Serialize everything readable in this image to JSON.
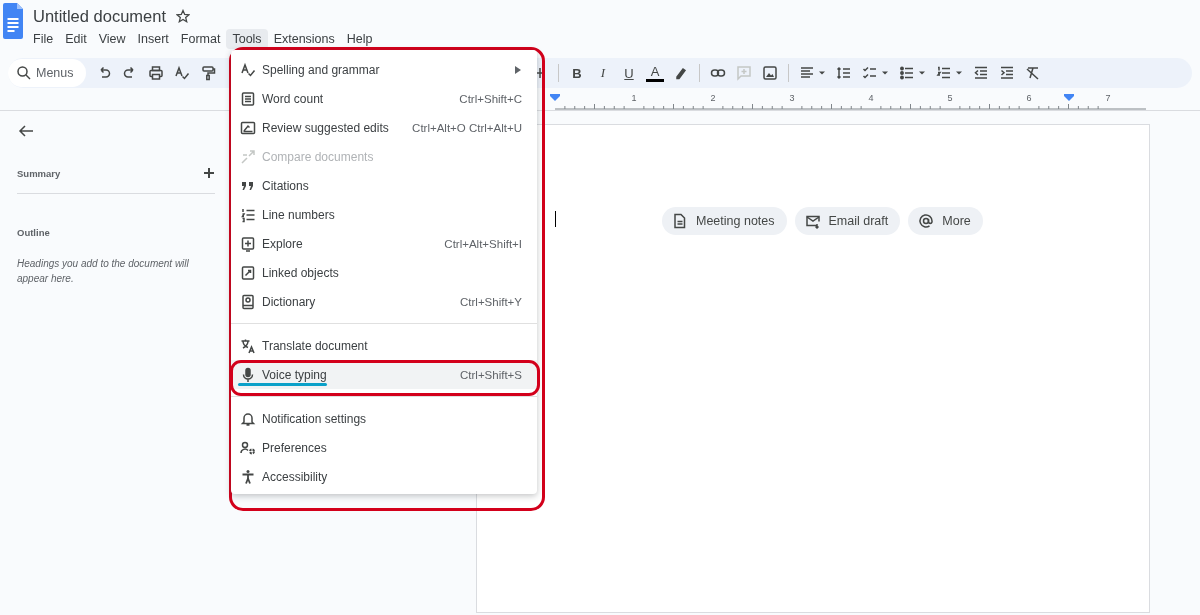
{
  "document": {
    "title": "Untitled document"
  },
  "menubar": [
    {
      "label": "File",
      "selected": false
    },
    {
      "label": "Edit",
      "selected": false
    },
    {
      "label": "View",
      "selected": false
    },
    {
      "label": "Insert",
      "selected": false
    },
    {
      "label": "Format",
      "selected": false
    },
    {
      "label": "Tools",
      "selected": true
    },
    {
      "label": "Extensions",
      "selected": false
    },
    {
      "label": "Help",
      "selected": false
    }
  ],
  "toolbar": {
    "search": {
      "placeholder": "Menus"
    },
    "format_letters": [
      "B",
      "I",
      "U",
      "A"
    ]
  },
  "ruler": {
    "labels": [
      "1",
      "2",
      "3",
      "4",
      "5",
      "6",
      "7"
    ]
  },
  "sidebar": {
    "summary_heading": "Summary",
    "outline_heading": "Outline",
    "outline_hint": "Headings you add to the document will appear here."
  },
  "page": {
    "chips": [
      {
        "label": "Meeting notes"
      },
      {
        "label": "Email draft"
      },
      {
        "label": "More"
      }
    ]
  },
  "tools_menu": {
    "circled": true,
    "items": [
      {
        "kind": "item",
        "label": "Spelling and grammar",
        "submenu": true,
        "disabled": false,
        "highlighted": false,
        "circled": false
      },
      {
        "kind": "item",
        "label": "Word count",
        "shortcut": "Ctrl+Shift+C",
        "submenu": false,
        "disabled": false,
        "highlighted": false,
        "circled": false
      },
      {
        "kind": "item",
        "label": "Review suggested edits",
        "shortcut": "Ctrl+Alt+O Ctrl+Alt+U",
        "submenu": false,
        "disabled": false,
        "highlighted": false,
        "circled": false
      },
      {
        "kind": "item",
        "label": "Compare documents",
        "submenu": false,
        "disabled": true,
        "highlighted": false,
        "circled": false
      },
      {
        "kind": "item",
        "label": "Citations",
        "submenu": false,
        "disabled": false,
        "highlighted": false,
        "circled": false
      },
      {
        "kind": "item",
        "label": "Line numbers",
        "submenu": false,
        "disabled": false,
        "highlighted": false,
        "circled": false
      },
      {
        "kind": "item",
        "label": "Explore",
        "shortcut": "Ctrl+Alt+Shift+I",
        "submenu": false,
        "disabled": false,
        "highlighted": false,
        "circled": false
      },
      {
        "kind": "item",
        "label": "Linked objects",
        "submenu": false,
        "disabled": false,
        "highlighted": false,
        "circled": false
      },
      {
        "kind": "item",
        "label": "Dictionary",
        "shortcut": "Ctrl+Shift+Y",
        "submenu": false,
        "disabled": false,
        "highlighted": false,
        "circled": false
      },
      {
        "kind": "divider"
      },
      {
        "kind": "item",
        "label": "Translate document",
        "submenu": false,
        "disabled": false,
        "highlighted": false,
        "circled": false
      },
      {
        "kind": "item",
        "label": "Voice typing",
        "shortcut": "Ctrl+Shift+S",
        "submenu": false,
        "disabled": false,
        "highlighted": true,
        "circled": true
      },
      {
        "kind": "divider"
      },
      {
        "kind": "item",
        "label": "Notification settings",
        "submenu": false,
        "disabled": false,
        "highlighted": false,
        "circled": false
      },
      {
        "kind": "item",
        "label": "Preferences",
        "submenu": false,
        "disabled": false,
        "highlighted": false,
        "circled": false
      },
      {
        "kind": "item",
        "label": "Accessibility",
        "submenu": false,
        "disabled": false,
        "highlighted": false,
        "circled": false
      }
    ]
  }
}
